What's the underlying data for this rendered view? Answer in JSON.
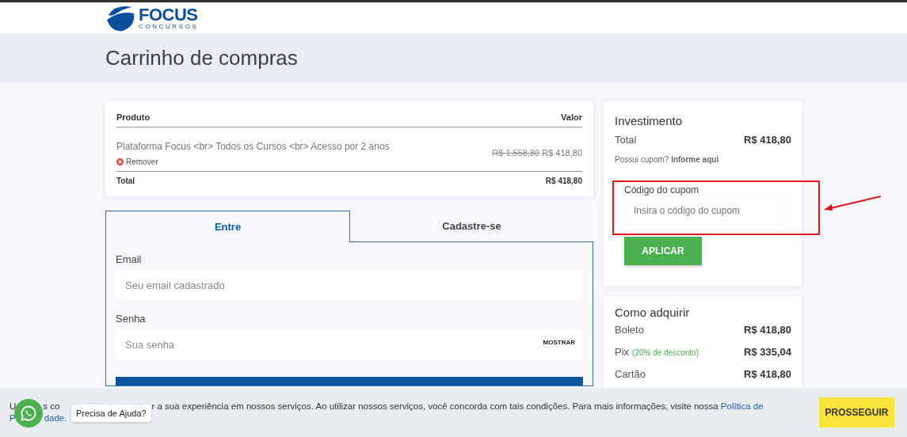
{
  "header": {
    "logo": {
      "name": "FOCUS",
      "tagline": "CONCURSOS"
    }
  },
  "page_title": "Carrinho de compras",
  "cart": {
    "columns": [
      "Produto",
      "Valor"
    ],
    "items": [
      {
        "name": "Plataforma Focus <br> Todos os Cursos <br> Acesso por 2 anos",
        "remove": "Remover",
        "old_price": "R$ 1.558,80",
        "price": "R$ 418,80"
      }
    ],
    "total_label": "Total",
    "total": "R$ 418,80"
  },
  "auth_tabs": [
    {
      "label": "Entre",
      "selected": true
    },
    {
      "label": "Cadastre-se",
      "selected": false
    }
  ],
  "login": {
    "fields": [
      {
        "label": "Email",
        "placeholder": "Seu email cadastrado"
      },
      {
        "label": "Senha",
        "placeholder": "Sua senha",
        "toggle": "MOSTRAR"
      }
    ]
  },
  "investment": {
    "title": "Investimento",
    "total_label": "Total",
    "total": "R$ 418,80",
    "coupon_prompt": "Possui cupom?",
    "coupon_link": "Informe aqui",
    "coupon_label": "Código do cupom",
    "coupon_placeholder": "Insira o código do cupom",
    "apply": "APLICAR"
  },
  "payment": {
    "title": "Como adquirir",
    "methods": [
      {
        "name": "Boleto",
        "price": "R$ 418,80"
      },
      {
        "name": "Pix",
        "note": "(20% de desconto)",
        "price": "R$ 335,04"
      },
      {
        "name": "Cartão",
        "price": "R$ 418,80"
      }
    ]
  },
  "cookie_banner": {
    "line1_start": "U",
    "line1_fragment": "s co",
    "text": "r a sua experiência em nossos serviços. Ao utilizar nossos serviços, você concorda com tais condições. Para mais informações, visite nossa",
    "link_start": "Política de",
    "line2_start": "P",
    "link_end": "dade.",
    "button": "PROSSEGUIR"
  },
  "help_chip": "Precisa de Ajuda?"
}
